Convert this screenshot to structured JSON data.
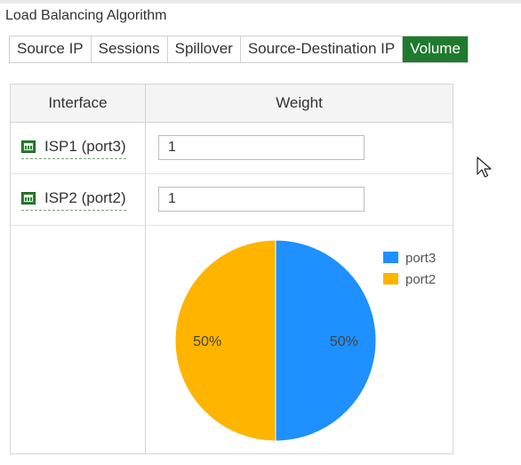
{
  "section": {
    "title": "Load Balancing Algorithm"
  },
  "tabs": [
    {
      "label": "Source IP"
    },
    {
      "label": "Sessions"
    },
    {
      "label": "Spillover"
    },
    {
      "label": "Source-Destination IP"
    },
    {
      "label": "Volume",
      "active": true
    }
  ],
  "table": {
    "headers": {
      "interface": "Interface",
      "weight": "Weight"
    },
    "rows": [
      {
        "interface": "ISP1 (port3)",
        "weight": "1",
        "icon": "network-port-icon"
      },
      {
        "interface": "ISP2 (port2)",
        "weight": "1",
        "icon": "network-port-icon"
      }
    ]
  },
  "colors": {
    "active_tab": "#1f7a2e",
    "port3": "#1e90ff",
    "port2": "#ffb400"
  },
  "chart_data": {
    "type": "pie",
    "categories": [
      "port3",
      "port2"
    ],
    "values": [
      50,
      50
    ],
    "labels": [
      "50%",
      "50%"
    ],
    "colors": [
      "#1e90ff",
      "#ffb400"
    ],
    "legend": [
      "port3",
      "port2"
    ],
    "legend_position": "top-right"
  }
}
